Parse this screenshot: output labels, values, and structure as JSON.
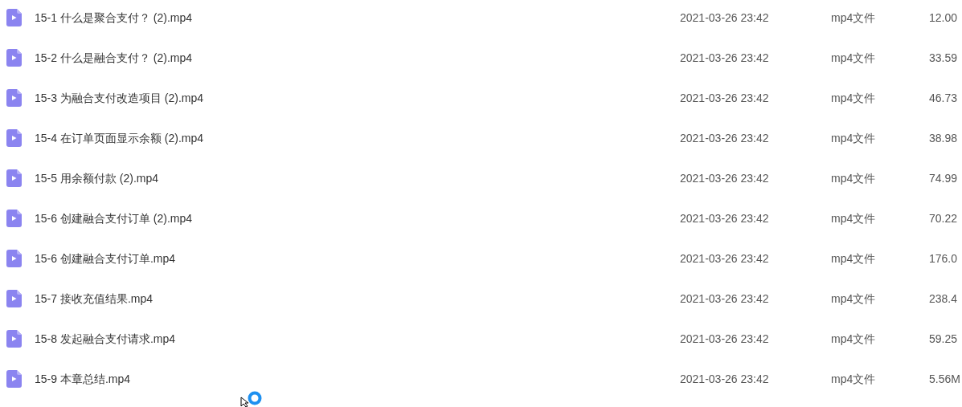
{
  "files": [
    {
      "name": "15-1 什么是聚合支付？ (2).mp4",
      "modified": "2021-03-26 23:42",
      "type": "mp4文件",
      "size": "12.00"
    },
    {
      "name": "15-2 什么是融合支付？ (2).mp4",
      "modified": "2021-03-26 23:42",
      "type": "mp4文件",
      "size": "33.59"
    },
    {
      "name": "15-3 为融合支付改造项目 (2).mp4",
      "modified": "2021-03-26 23:42",
      "type": "mp4文件",
      "size": "46.73"
    },
    {
      "name": "15-4 在订单页面显示余额 (2).mp4",
      "modified": "2021-03-26 23:42",
      "type": "mp4文件",
      "size": "38.98"
    },
    {
      "name": "15-5 用余额付款 (2).mp4",
      "modified": "2021-03-26 23:42",
      "type": "mp4文件",
      "size": "74.99"
    },
    {
      "name": "15-6 创建融合支付订单 (2).mp4",
      "modified": "2021-03-26 23:42",
      "type": "mp4文件",
      "size": "70.22"
    },
    {
      "name": "15-6 创建融合支付订单.mp4",
      "modified": "2021-03-26 23:42",
      "type": "mp4文件",
      "size": "176.0"
    },
    {
      "name": "15-7 接收充值结果.mp4",
      "modified": "2021-03-26 23:42",
      "type": "mp4文件",
      "size": "238.4"
    },
    {
      "name": "15-8 发起融合支付请求.mp4",
      "modified": "2021-03-26 23:42",
      "type": "mp4文件",
      "size": "59.25"
    },
    {
      "name": "15-9 本章总结.mp4",
      "modified": "2021-03-26 23:42",
      "type": "mp4文件",
      "size": "5.56M"
    }
  ]
}
